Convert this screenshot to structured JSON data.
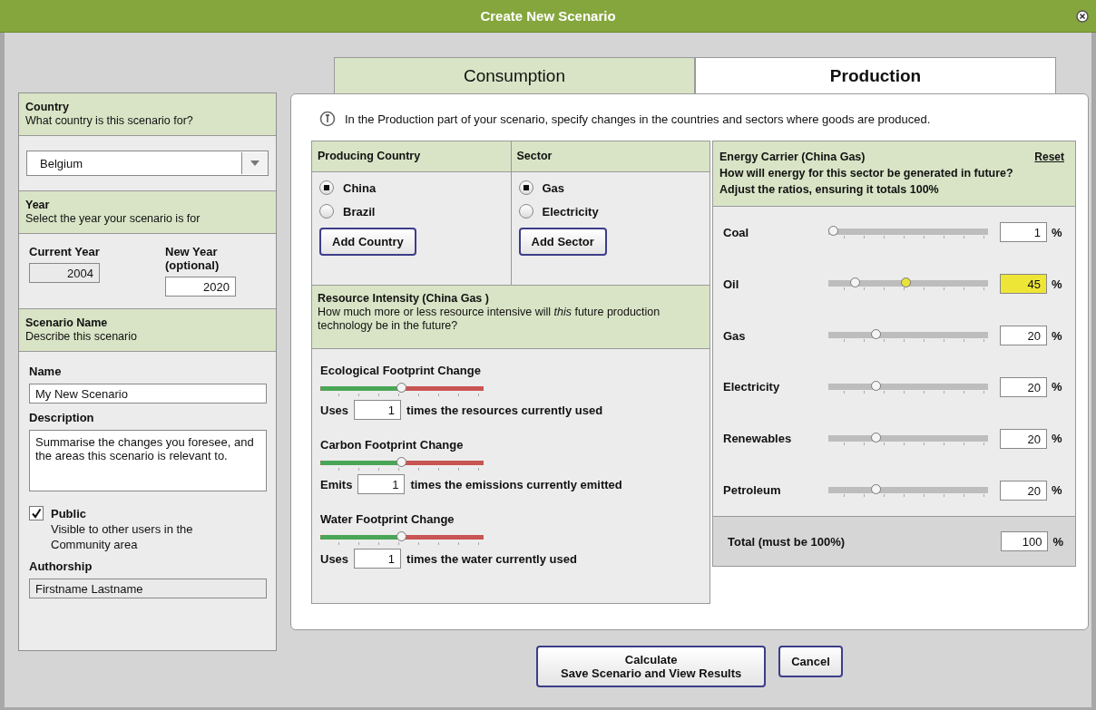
{
  "window": {
    "title": "Create New Scenario"
  },
  "tabs": [
    {
      "label": "Consumption",
      "selected": false
    },
    {
      "label": "Production",
      "selected": true
    }
  ],
  "left_panel": {
    "country": {
      "heading": "Country",
      "subheading": "What country is this scenario for?",
      "value": "Belgium"
    },
    "year": {
      "heading": "Year",
      "subheading": "Select the year your scenario is for",
      "current_label": "Current Year",
      "current_value": "2004",
      "new_label": "New Year (optional)",
      "new_value": "2020"
    },
    "scenario": {
      "heading": "Scenario Name",
      "subheading": "Describe this scenario",
      "name_label": "Name",
      "name_value": "My New Scenario",
      "description_label": "Description",
      "description_value": "Summarise the changes you foresee, and the areas this scenario is relevant to.",
      "public": {
        "label": "Public",
        "note": "Visible to other users in the Community area",
        "checked": true
      },
      "authorship_label": "Authorship",
      "authorship_value": "Firstname Lastname"
    }
  },
  "production": {
    "info": "In the Production part of your scenario, specify changes in the countries and sectors where goods are produced.",
    "producing_country": {
      "heading": "Producing Country",
      "options": [
        {
          "label": "China",
          "selected": true
        },
        {
          "label": "Brazil",
          "selected": false
        }
      ],
      "button": "Add Country"
    },
    "sector": {
      "heading": "Sector",
      "options": [
        {
          "label": "Gas",
          "selected": true
        },
        {
          "label": "Electricity",
          "selected": false
        }
      ],
      "button": "Add Sector"
    },
    "resource_intensity": {
      "heading": "Resource Intensity (China Gas )",
      "subheading": "How much more or less resource intensive will *this* future production technology be in the future?",
      "sliders": [
        {
          "title": "Ecological Footprint Change",
          "level": 0.5,
          "prefix": "Uses",
          "value": "1",
          "suffix": "times the resources currently used"
        },
        {
          "title": "Carbon Footprint Change",
          "level": 0.5,
          "prefix": "Emits",
          "value": "1",
          "suffix": "times the emissions currently emitted"
        },
        {
          "title": "Water Footprint Change",
          "level": 0.5,
          "prefix": "Uses",
          "value": "1",
          "suffix": "times the water currently used"
        }
      ]
    },
    "energy_carrier": {
      "heading": "Energy Carrier (China Gas)",
      "reset": "Reset",
      "question": "How will energy for this sector be generated in future?",
      "instruction": "Adjust the ratios, ensuring it totals 100%",
      "rows": [
        {
          "label": "Coal",
          "level": 0.05,
          "value": "1",
          "unit": "%",
          "highlighted": false
        },
        {
          "label": "Oil",
          "level": 0.49,
          "original": {
            "level": 0.18
          },
          "value": "45",
          "unit": "%",
          "highlighted": true
        },
        {
          "label": "Gas",
          "level": 0.31,
          "value": "20",
          "unit": "%",
          "highlighted": false
        },
        {
          "label": "Electricity",
          "level": 0.31,
          "value": "20",
          "unit": "%",
          "highlighted": false
        },
        {
          "label": "Renewables",
          "level": 0.31,
          "value": "20",
          "unit": "%",
          "highlighted": false
        },
        {
          "label": "Petroleum",
          "level": 0.31,
          "value": "20",
          "unit": "%",
          "highlighted": false
        }
      ],
      "total": {
        "label": "Total (must be 100%)",
        "value": "100",
        "unit": "%"
      }
    }
  },
  "buttons": [
    {
      "kind": "primary",
      "label": "Calculate",
      "sublabel": "Save Scenario and View Results"
    },
    {
      "kind": "plain",
      "label": "Cancel"
    }
  ]
}
